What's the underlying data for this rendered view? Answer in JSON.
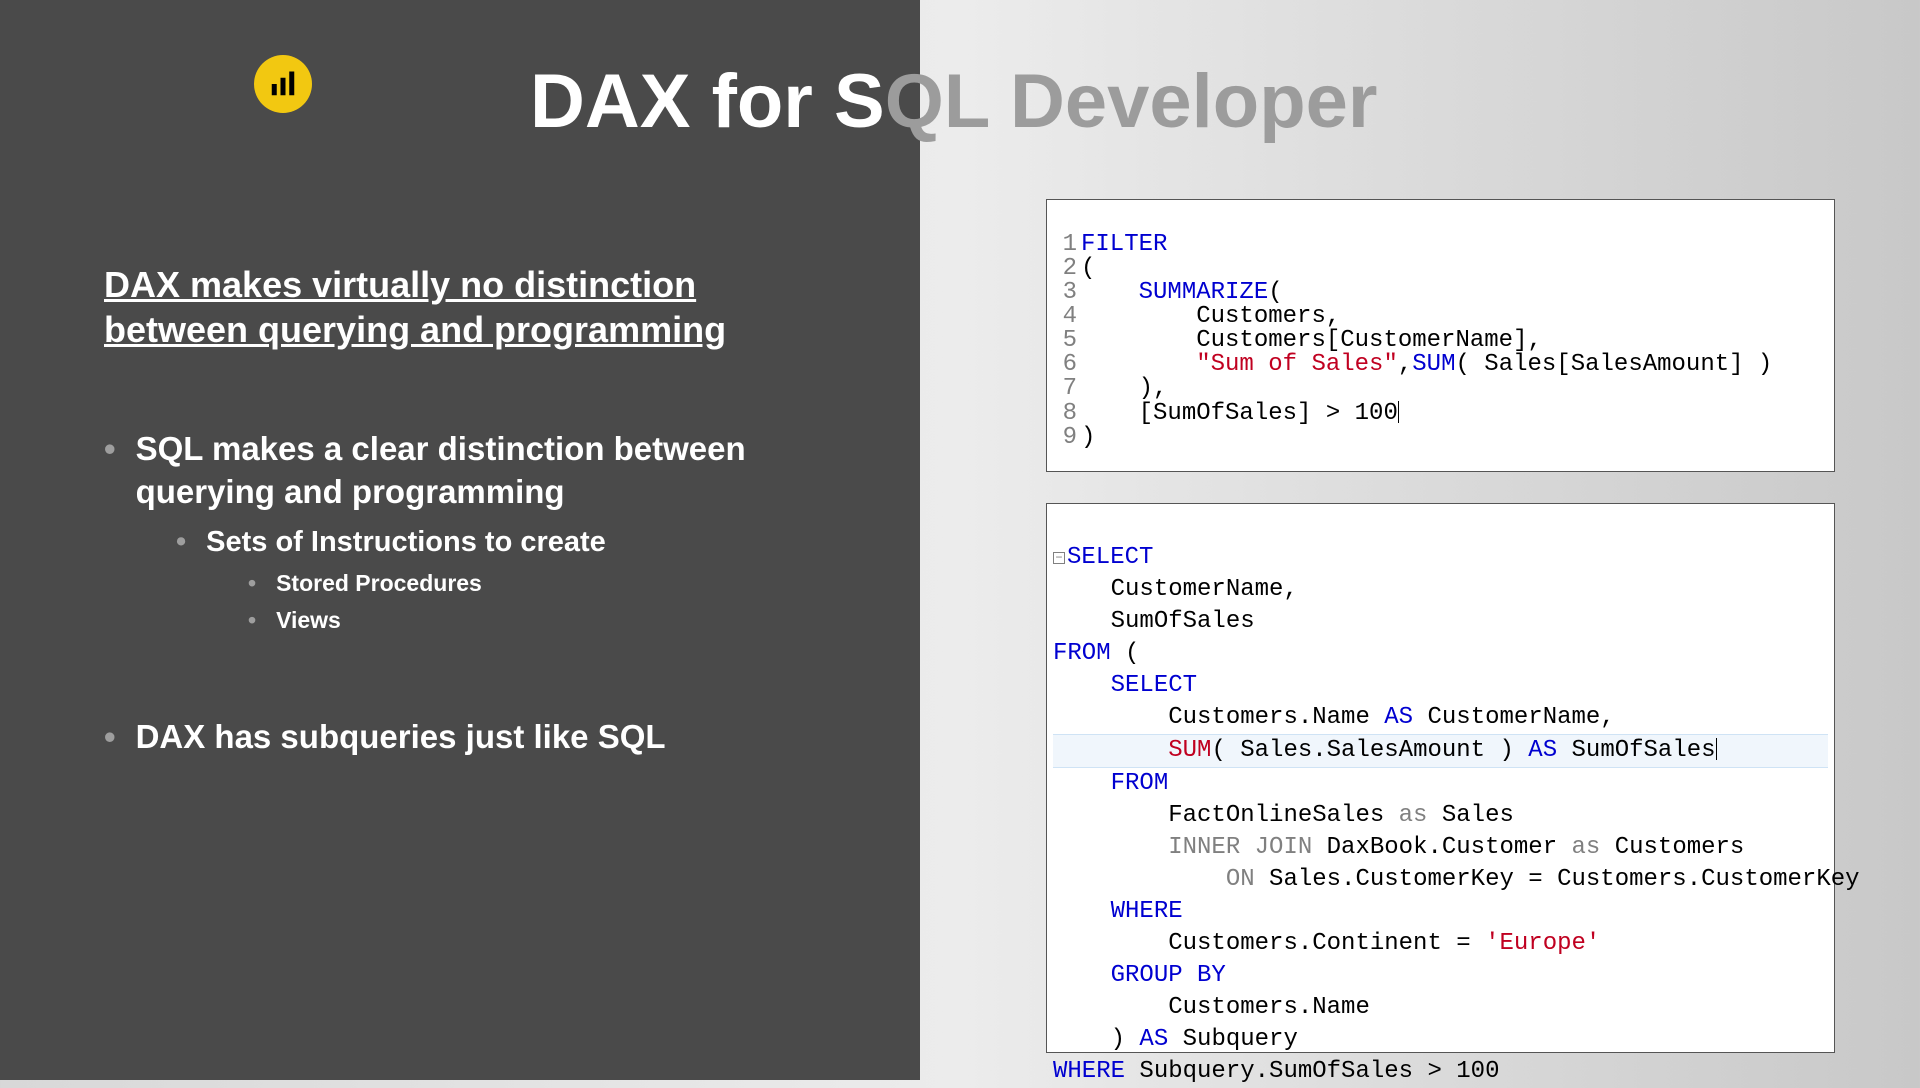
{
  "title_left": "DAX for S",
  "title_right": "QL Developer",
  "subtitle": "DAX makes virtually no distinction between querying and programming",
  "bullets": {
    "b1": "SQL makes a clear distinction between querying and programming",
    "b1a": "Sets of Instructions to create",
    "b1a1": "Stored Procedures",
    "b1a2": "Views",
    "b2": "DAX has subqueries just like SQL"
  },
  "dax": {
    "l1_kw": "FILTER",
    "l2": "(",
    "l3_kw": "SUMMARIZE",
    "l3_paren": "(",
    "l4": "Customers,",
    "l5": "Customers[CustomerName],",
    "l6_str": "\"Sum of Sales\"",
    "l6_comma": ",",
    "l6_sum": "SUM",
    "l6_rest": "( Sales[SalesAmount] )",
    "l7": "),",
    "l8": "[SumOfSales] > 100",
    "l9": ")"
  },
  "sql": {
    "l1_kw": "SELECT",
    "l2": "CustomerName,",
    "l3": "SumOfSales",
    "l4_kw": "FROM",
    "l4_rest": " (",
    "l5_kw": "SELECT",
    "l6_a": "Customers.Name ",
    "l6_as": "AS",
    "l6_b": " CustomerName,",
    "l7_sum": "SUM",
    "l7_a": "( Sales.SalesAmount ) ",
    "l7_as": "AS",
    "l7_b": " SumOfSales",
    "l8_kw": "FROM",
    "l9_a": "FactOnlineSales ",
    "l9_as": "as",
    "l9_b": " Sales",
    "l10_kw": "INNER JOIN",
    "l10_a": " DaxBook.Customer ",
    "l10_as": "as",
    "l10_b": " Customers",
    "l11_on": "ON",
    "l11_rest": " Sales.CustomerKey = Customers.CustomerKey",
    "l12_kw": "WHERE",
    "l13_a": "Customers.Continent = ",
    "l13_str": "'Europe'",
    "l14_kw": "GROUP BY",
    "l15": "Customers.Name",
    "l16_a": ") ",
    "l16_as": "AS",
    "l16_b": " Subquery",
    "l17_kw": "WHERE",
    "l17_rest": " Subquery.SumOfSales > 100"
  }
}
